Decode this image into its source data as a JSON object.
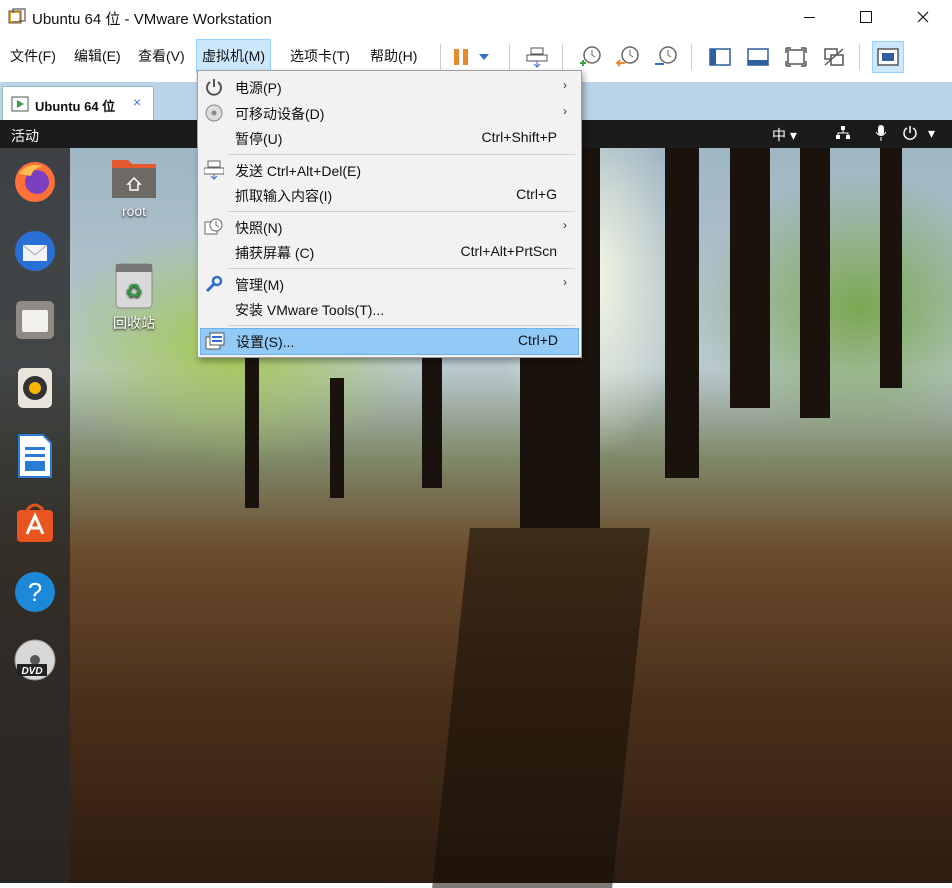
{
  "window": {
    "title": "Ubuntu 64 位 - VMware Workstation"
  },
  "menubar": {
    "items": [
      "文件(F)",
      "编辑(E)",
      "查看(V)",
      "虚拟机(M)",
      "选项卡(T)",
      "帮助(H)"
    ],
    "active_index": 3
  },
  "toolbar": {
    "buttons": [
      "pause-icon",
      "dropdown-arrow-icon",
      "send-keys-icon",
      "snapshot-take-icon",
      "snapshot-revert-icon",
      "snapshot-manager-icon",
      "library-view-icon",
      "console-view-icon",
      "fullscreen-icon",
      "unity-disabled-icon",
      "thumbnail-view-icon"
    ]
  },
  "tabs": [
    {
      "label": "Ubuntu 64 位",
      "close": "×"
    }
  ],
  "guest": {
    "activities": "活动",
    "input_method": "中",
    "dropdown_glyph": "▾"
  },
  "dock": {
    "items": [
      "firefox-icon",
      "thunderbird-icon",
      "files-icon",
      "rhythmbox-icon",
      "libreoffice-writer-icon",
      "software-center-icon",
      "help-icon",
      "dvd-icon"
    ]
  },
  "desktop": {
    "icons": [
      {
        "label": "root",
        "icon": "home-folder-icon"
      },
      {
        "label": "回收站",
        "icon": "trash-icon"
      }
    ]
  },
  "vm_menu": {
    "items": [
      {
        "label": "电源(P)",
        "shortcut": "",
        "submenu": true,
        "icon": "power-icon"
      },
      {
        "label": "可移动设备(D)",
        "shortcut": "",
        "submenu": true,
        "icon": "disc-icon"
      },
      {
        "label": "暂停(U)",
        "shortcut": "Ctrl+Shift+P",
        "submenu": false,
        "icon": ""
      },
      {
        "label": "发送 Ctrl+Alt+Del(E)",
        "shortcut": "",
        "submenu": false,
        "icon": "send-keys-icon"
      },
      {
        "label": "抓取输入内容(I)",
        "shortcut": "Ctrl+G",
        "submenu": false,
        "icon": ""
      },
      {
        "label": "快照(N)",
        "shortcut": "",
        "submenu": true,
        "icon": "snapshot-icon"
      },
      {
        "label": "捕获屏幕 (C)",
        "shortcut": "Ctrl+Alt+PrtScn",
        "submenu": false,
        "icon": ""
      },
      {
        "label": "管理(M)",
        "shortcut": "",
        "submenu": true,
        "icon": "wrench-icon"
      },
      {
        "label": "安装 VMware Tools(T)...",
        "shortcut": "",
        "submenu": false,
        "icon": ""
      },
      {
        "label": "设置(S)...",
        "shortcut": "Ctrl+D",
        "submenu": false,
        "icon": "settings-icon",
        "highlighted": true
      }
    ],
    "submenu_arrow": "›"
  },
  "colors": {
    "menu_highlight": "#91c9f7",
    "active_menu": "#cce8ff",
    "pause_orange": "#e8892b",
    "accent_blue": "#3b7dd8"
  }
}
